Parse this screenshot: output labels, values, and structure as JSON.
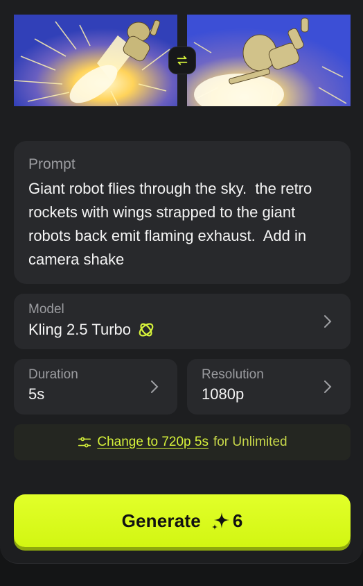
{
  "frames": {
    "start_label": "",
    "end_label": ""
  },
  "prompt": {
    "label": "Prompt",
    "text": "Giant robot flies through the sky.  the retro rockets with wings strapped to the giant robots back emit flaming exhaust.  Add in camera shake"
  },
  "model": {
    "label": "Model",
    "value": "Kling 2.5 Turbo",
    "badge_icon": "kling-logo-icon"
  },
  "duration": {
    "label": "Duration",
    "value": "5s"
  },
  "resolution": {
    "label": "Resolution",
    "value": "1080p"
  },
  "promo": {
    "icon": "sliders-icon",
    "link_text": "Change to 720p 5s",
    "suffix": "for Unlimited"
  },
  "generate": {
    "label": "Generate",
    "icon": "sparkle-icon",
    "cost": "6"
  },
  "colors": {
    "accent": "#d6f23a",
    "button": "#dcfb1f",
    "panel": "#1d1e20",
    "card": "#28292c"
  }
}
